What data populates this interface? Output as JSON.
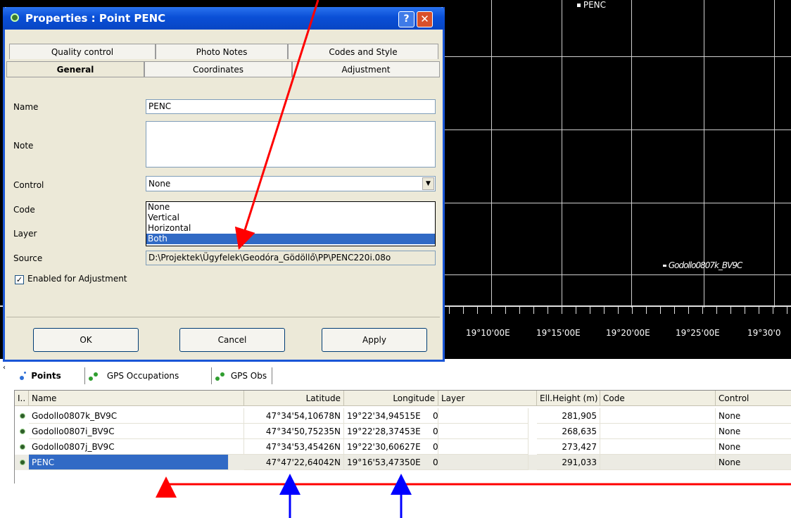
{
  "map": {
    "point_label": "PENC",
    "cluster_label": "Godollo0807k_BV9C",
    "longitude_ticks": [
      "19°10'00E",
      "19°15'00E",
      "19°20'00E",
      "19°25'00E",
      "19°30'0"
    ]
  },
  "dialog": {
    "title": "Properties : Point PENC",
    "help_glyph": "?",
    "close_glyph": "✕",
    "tabs_row1": [
      "Quality control",
      "Photo Notes",
      "Codes and Style"
    ],
    "tabs_row2": [
      "General",
      "Coordinates",
      "Adjustment"
    ],
    "active_tab": "General",
    "fields": {
      "name_label": "Name",
      "name_value": "PENC",
      "note_label": "Note",
      "note_value": "",
      "control_label": "Control",
      "control_value": "None",
      "code_label": "Code",
      "layer_label": "Layer",
      "source_label": "Source",
      "source_value": "D:\\Projektek\\Ügyfelek\\Geodóra_Gödöllő\\PP\\PENC220i.08o",
      "enabled_label": "Enabled for Adjustment",
      "enabled_checked": true
    },
    "control_options": [
      "None",
      "Vertical",
      "Horizontal",
      "Both"
    ],
    "control_highlighted": "Both",
    "buttons": {
      "ok": "OK",
      "cancel": "Cancel",
      "apply": "Apply"
    }
  },
  "bottom_panel": {
    "tabs": [
      "Points",
      "GPS Occupations",
      "GPS Obs"
    ],
    "active_tab": "Points",
    "columns": [
      "I..",
      "Name",
      "Latitude",
      "Longitude",
      "Layer",
      "Ell.Height (m)",
      "Code",
      "Control"
    ],
    "rows": [
      {
        "name": "Godollo0807k_BV9C",
        "latitude": "47°34'54,10678N",
        "longitude": "19°22'34,94515E",
        "layer": "0",
        "height": "281,905",
        "code": "",
        "control": "None"
      },
      {
        "name": "Godollo0807i_BV9C",
        "latitude": "47°34'50,75235N",
        "longitude": "19°22'28,37453E",
        "layer": "0",
        "height": "268,635",
        "code": "",
        "control": "None"
      },
      {
        "name": "Godollo0807j_BV9C",
        "latitude": "47°34'53,45426N",
        "longitude": "19°22'30,60627E",
        "layer": "0",
        "height": "273,427",
        "code": "",
        "control": "None"
      },
      {
        "name": "PENC",
        "latitude": "47°47'22,64042N",
        "longitude": "19°16'53,47350E",
        "layer": "0",
        "height": "291,033",
        "code": "",
        "control": "None"
      }
    ],
    "selected_row": "PENC"
  },
  "annotation_colors": {
    "red": "#ff0000",
    "blue": "#0000ff"
  }
}
